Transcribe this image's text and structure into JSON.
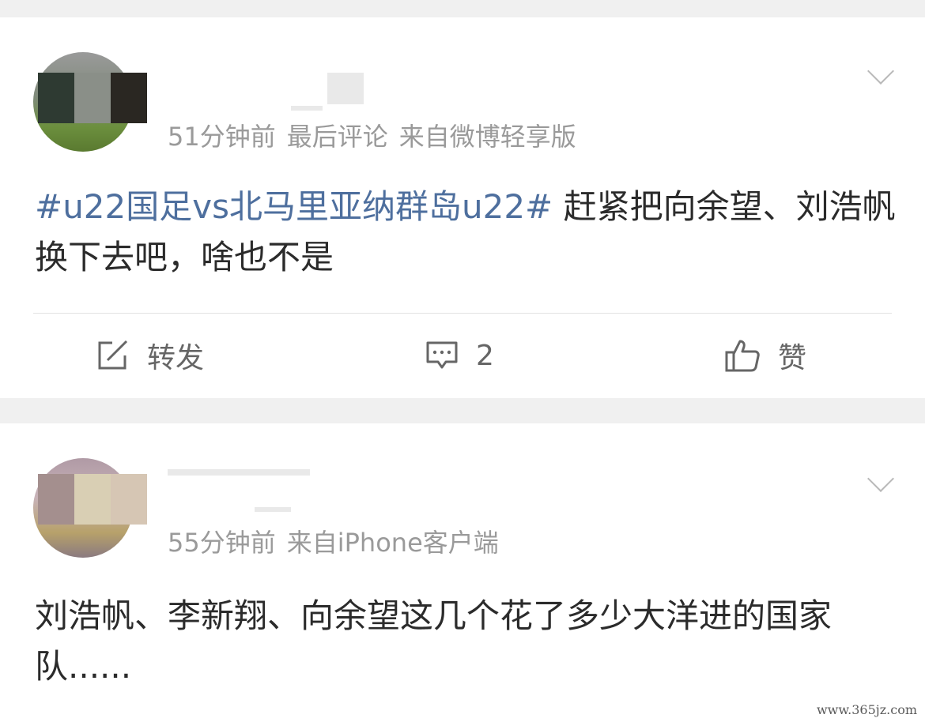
{
  "posts": [
    {
      "time": "51分钟前",
      "extra": "最后评论",
      "source": "来自微博轻享版",
      "topic": "#u22国足vs北马里亚纳群岛u22#",
      "text": " 赶紧把向余望、刘浩帆换下去吧，啥也不是",
      "actions": {
        "repost_label": "转发",
        "comment_count": "2",
        "like_label": "赞"
      }
    },
    {
      "time": "55分钟前",
      "source": "来自iPhone客户端",
      "text": "刘浩帆、李新翔、向余望这几个花了多少大洋进的国家队......"
    }
  ],
  "watermark": "www.365jz.com",
  "icons": {
    "repost": "share-edit-icon",
    "comment": "comment-bubble-icon",
    "like": "thumbs-up-icon",
    "menu": "chevron-down-icon"
  },
  "colors": {
    "topic": "#4e6f9e",
    "meta": "#9a9a9a",
    "background": "#f0f0f0"
  }
}
